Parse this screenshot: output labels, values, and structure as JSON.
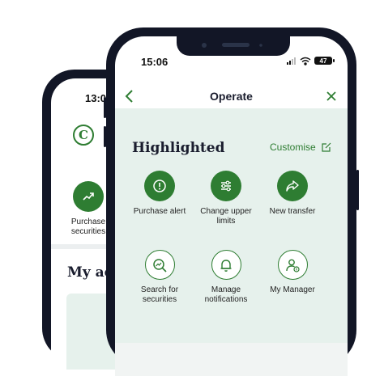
{
  "back_phone": {
    "time": "13:06",
    "logo": "C",
    "action": {
      "label": "Purchase securities",
      "icon": "trend-up-icon"
    },
    "heading": "My ac"
  },
  "front_phone": {
    "status": {
      "time": "15:06",
      "battery": "47"
    },
    "header": {
      "title": "Operate",
      "back_icon": "chevron-left-icon",
      "close_icon": "close-icon"
    },
    "highlighted": {
      "title": "Highlighted",
      "customise": "Customise",
      "actions": [
        {
          "label": "Purchase alert",
          "icon": "alert-icon",
          "style": "filled"
        },
        {
          "label": "Change upper limits",
          "icon": "sliders-icon",
          "style": "filled"
        },
        {
          "label": "New transfer",
          "icon": "share-arrow-icon",
          "style": "filled"
        },
        {
          "label": "Search for securities",
          "icon": "search-chart-icon",
          "style": "outline"
        },
        {
          "label": "Manage notifications",
          "icon": "bell-icon",
          "style": "outline"
        },
        {
          "label": "My Manager",
          "icon": "manager-icon",
          "style": "outline"
        }
      ]
    }
  },
  "colors": {
    "brand_green": "#2e7d32",
    "panel_bg": "#e6f1ec",
    "phone_frame": "#121626"
  }
}
